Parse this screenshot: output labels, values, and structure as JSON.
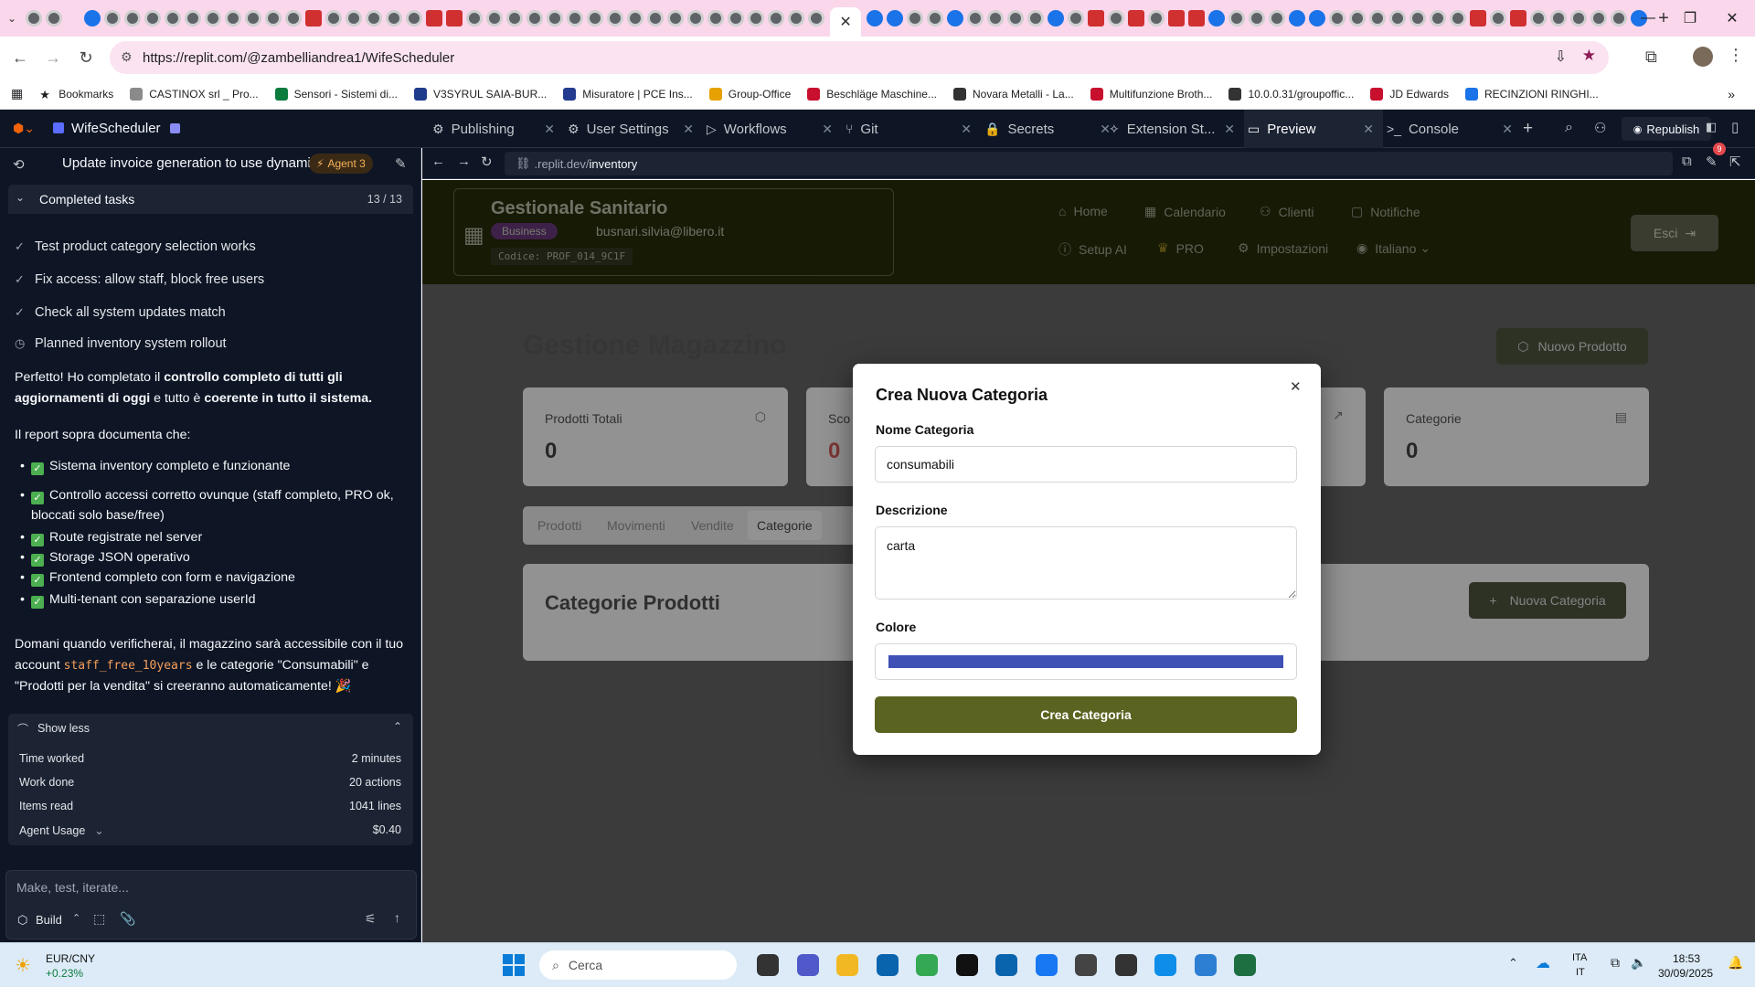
{
  "browser": {
    "url": "https://replit.com/@zambelliandrea1/WifeScheduler",
    "new_tab": "+",
    "bookmarks": [
      {
        "label": "Bookmarks",
        "color": "#333"
      },
      {
        "label": "CASTINOX srl _ Pro...",
        "color": "#8a8a8a"
      },
      {
        "label": "Sensori - Sistemi di...",
        "color": "#0b7b3e"
      },
      {
        "label": "V3SYRUL SAIA-BUR...",
        "color": "#1f3b8c"
      },
      {
        "label": "Misuratore | PCE Ins...",
        "color": "#233b8f"
      },
      {
        "label": "Group-Office",
        "color": "#e6a100"
      },
      {
        "label": "Beschläge Maschine...",
        "color": "#c8102e"
      },
      {
        "label": "Novara Metalli - La...",
        "color": "#333"
      },
      {
        "label": "Multifunzione Broth...",
        "color": "#c8102e"
      },
      {
        "label": "10.0.0.31/groupoffic...",
        "color": "#333"
      },
      {
        "label": "JD Edwards",
        "color": "#c8102e"
      },
      {
        "label": "RECINZIONI RINGHI...",
        "color": "#1a73e8"
      }
    ]
  },
  "replit": {
    "project_name": "WifeScheduler",
    "tabs": [
      {
        "label": "Publishing",
        "icon": "publish-icon",
        "glyph": "⚙"
      },
      {
        "label": "User Settings",
        "icon": "gear-icon",
        "glyph": "⚙"
      },
      {
        "label": "Workflows",
        "icon": "play-icon",
        "glyph": "▷"
      },
      {
        "label": "Git",
        "icon": "git-icon",
        "glyph": "⑂"
      },
      {
        "label": "Secrets",
        "icon": "lock-icon",
        "glyph": "🔒"
      },
      {
        "label": "Extension St...",
        "icon": "puzzle-icon",
        "glyph": "✧"
      },
      {
        "label": "Preview",
        "icon": "monitor-icon",
        "glyph": "▭"
      },
      {
        "label": "Console",
        "icon": "terminal-icon",
        "glyph": ">_"
      }
    ],
    "republish_label": "Republish",
    "notification_count": "9",
    "thread_title": "Update invoice generation to use dynami...",
    "agent_label": "Agent 3",
    "completed_label": "Completed tasks",
    "completed_count": "13 / 13",
    "tasks": [
      "Test product category selection works",
      "Fix access: allow staff, block free users",
      "Check all system updates match",
      "Planned inventory system rollout"
    ],
    "msg": {
      "p1_a": "Perfetto! Ho completato il ",
      "p1_b": "controllo completo di tutti gli aggiornamenti di oggi",
      "p1_c": " e tutto è ",
      "p1_d": "coerente in tutto il sistema.",
      "p2": "Il report sopra documenta che:",
      "bullets": [
        "Sistema inventory completo e funzionante",
        "Controllo accessi corretto ovunque (staff completo, PRO ok, bloccati solo base/free)",
        "Route registrate nel server",
        "Storage JSON operativo",
        "Frontend completo con form e navigazione",
        "Multi-tenant con separazione userId"
      ],
      "p3_a": "Domani quando verificherai, il magazzino sarà accessibile con il tuo account ",
      "p3_code": "staff_free_10years",
      "p3_b": " e le categorie \"Consumabili\" e \"Prodotti per la vendita\" si creeranno automaticamente! 🎉"
    },
    "show_less": "Show less",
    "stats": [
      {
        "label": "Time worked",
        "value": "2 minutes"
      },
      {
        "label": "Work done",
        "value": "20 actions"
      },
      {
        "label": "Items read",
        "value": "1041 lines"
      },
      {
        "label": "Agent Usage",
        "value": "$0.40"
      }
    ],
    "input_placeholder": "Make, test, iterate...",
    "build_label": "Build",
    "preview_url_prefix": ".replit.dev/",
    "preview_url_path": "inventory"
  },
  "app": {
    "brand": "Gestionale Sanitario",
    "plan_badge": "Business",
    "email": "busnari.silvia@libero.it",
    "code": "Codice: PROF_014_9C1F",
    "nav_row1": [
      "Home",
      "Calendario",
      "Clienti",
      "Notifiche"
    ],
    "nav_row2": [
      "Setup AI",
      "PRO",
      "Impostazioni",
      "Italiano"
    ],
    "logout": "Esci",
    "page_title": "Gestione Magazzino",
    "new_product": "Nuovo Prodotto",
    "cards": [
      {
        "label": "Prodotti Totali",
        "value": "0"
      },
      {
        "label": "Sco",
        "value": "0"
      },
      {
        "label": "Categorie",
        "value": "0"
      }
    ],
    "tabs": [
      "Prodotti",
      "Movimenti",
      "Vendite",
      "Categorie"
    ],
    "section_title": "Categorie Prodotti",
    "new_category": "Nuova Categoria"
  },
  "modal": {
    "title": "Crea Nuova Categoria",
    "name_label": "Nome Categoria",
    "name_value": "consumabili",
    "desc_label": "Descrizione",
    "desc_value": "carta",
    "color_label": "Colore",
    "color_value": "#3f51b5",
    "submit": "Crea Categoria",
    "submit_color": "#5b6320"
  },
  "taskbar": {
    "ticker": "EUR/CNY",
    "ticker_change": "+0.23%",
    "search": "Cerca",
    "lang1": "ITA",
    "lang2": "IT",
    "time": "18:53",
    "date": "30/09/2025"
  }
}
